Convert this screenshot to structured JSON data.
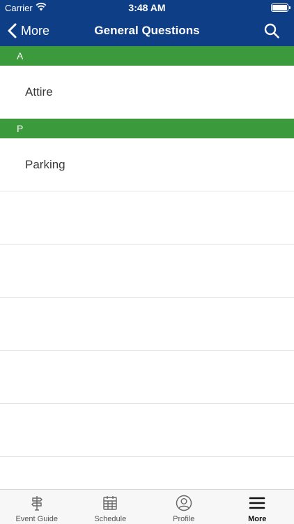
{
  "status_bar": {
    "carrier": "Carrier",
    "time": "3:48 AM"
  },
  "nav": {
    "back_label": "More",
    "title": "General Questions"
  },
  "sections": [
    {
      "header": "A",
      "items": [
        "Attire"
      ]
    },
    {
      "header": "P",
      "items": [
        "Parking"
      ]
    }
  ],
  "tabs": [
    {
      "label": "Event Guide",
      "icon": "signpost-icon"
    },
    {
      "label": "Schedule",
      "icon": "calendar-icon"
    },
    {
      "label": "Profile",
      "icon": "profile-icon"
    },
    {
      "label": "More",
      "icon": "menu-icon",
      "active": true
    }
  ],
  "colors": {
    "header_bg": "#0e3f86",
    "section_bg": "#3a9a3c"
  }
}
